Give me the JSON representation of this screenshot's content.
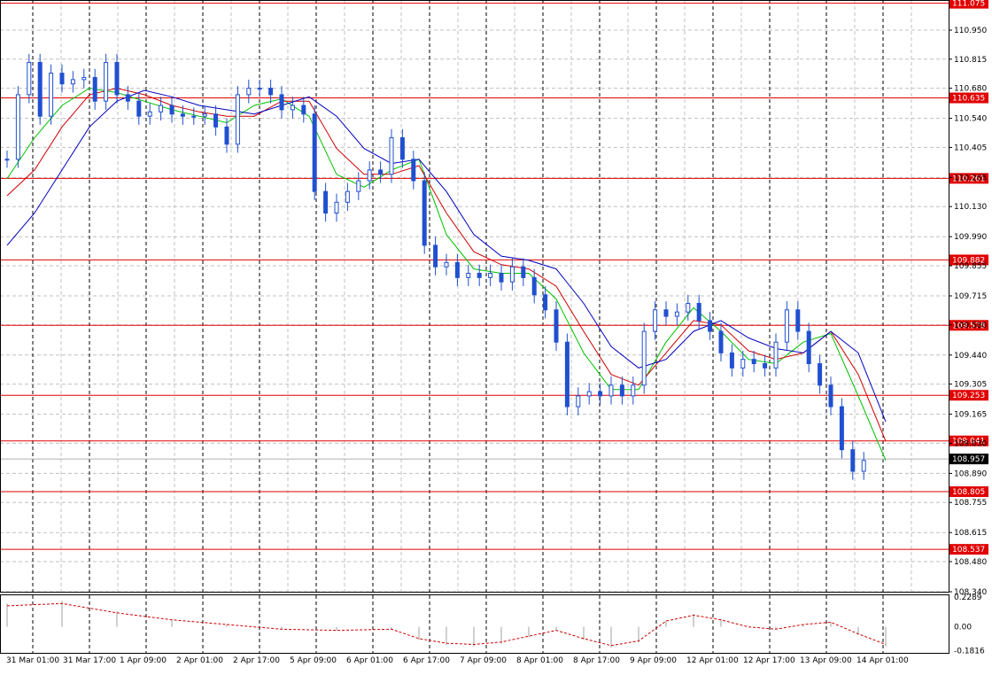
{
  "chart_data": [
    {
      "type": "candlestick",
      "instrument_panel": "main",
      "title": "",
      "x_tick_labels": [
        "31 Mar 01:00",
        "31 Mar 17:00",
        "1 Apr 09:00",
        "2 Apr 01:00",
        "2 Apr 17:00",
        "5 Apr 09:00",
        "6 Apr 01:00",
        "6 Apr 17:00",
        "7 Apr 09:00",
        "8 Apr 01:00",
        "8 Apr 17:00",
        "9 Apr 09:00",
        "12 Apr 01:00",
        "12 Apr 17:00",
        "13 Apr 09:00",
        "14 Apr 01:00"
      ],
      "y_tick_labels": [
        "110.950",
        "110.815",
        "110.680",
        "110.540",
        "110.405",
        "110.265",
        "110.130",
        "109.990",
        "109.855",
        "109.715",
        "109.580",
        "109.440",
        "109.305",
        "109.165",
        "109.030",
        "108.890",
        "108.755",
        "108.615",
        "108.480",
        "108.340"
      ],
      "ylim": [
        108.34,
        111.09
      ],
      "current_price": "108.957",
      "horizontal_levels": [
        "111.075",
        "110.635",
        "110.261",
        "109.882",
        "109.578",
        "109.253",
        "109.041",
        "108.805",
        "108.537"
      ],
      "close_path": [
        [
          0,
          110.35
        ],
        [
          8,
          110.65
        ],
        [
          16,
          110.8
        ],
        [
          24,
          110.55
        ],
        [
          32,
          110.75
        ],
        [
          40,
          110.7
        ],
        [
          48,
          110.72
        ],
        [
          56,
          110.73
        ],
        [
          64,
          110.62
        ],
        [
          72,
          110.8
        ],
        [
          80,
          110.65
        ],
        [
          88,
          110.62
        ],
        [
          96,
          110.55
        ],
        [
          104,
          110.57
        ],
        [
          112,
          110.6
        ],
        [
          120,
          110.56
        ],
        [
          128,
          110.55
        ],
        [
          136,
          110.55
        ],
        [
          144,
          110.56
        ],
        [
          152,
          110.5
        ],
        [
          160,
          110.42
        ],
        [
          168,
          110.65
        ],
        [
          176,
          110.68
        ],
        [
          184,
          110.68
        ],
        [
          192,
          110.65
        ],
        [
          200,
          110.58
        ],
        [
          208,
          110.6
        ],
        [
          216,
          110.56
        ],
        [
          224,
          110.2
        ],
        [
          232,
          110.1
        ],
        [
          240,
          110.15
        ],
        [
          248,
          110.2
        ],
        [
          256,
          110.25
        ],
        [
          264,
          110.3
        ],
        [
          272,
          110.28
        ],
        [
          280,
          110.45
        ],
        [
          288,
          110.35
        ],
        [
          296,
          110.25
        ],
        [
          304,
          109.95
        ],
        [
          312,
          109.85
        ],
        [
          320,
          109.87
        ],
        [
          328,
          109.8
        ],
        [
          336,
          109.82
        ],
        [
          344,
          109.8
        ],
        [
          352,
          109.82
        ],
        [
          360,
          109.78
        ],
        [
          368,
          109.85
        ],
        [
          376,
          109.8
        ],
        [
          384,
          109.72
        ],
        [
          392,
          109.65
        ],
        [
          400,
          109.5
        ],
        [
          408,
          109.2
        ],
        [
          416,
          109.25
        ],
        [
          424,
          109.27
        ],
        [
          432,
          109.25
        ],
        [
          440,
          109.3
        ],
        [
          448,
          109.25
        ],
        [
          456,
          109.3
        ],
        [
          464,
          109.55
        ],
        [
          472,
          109.65
        ],
        [
          480,
          109.62
        ],
        [
          488,
          109.64
        ],
        [
          496,
          109.68
        ],
        [
          504,
          109.6
        ],
        [
          512,
          109.55
        ],
        [
          520,
          109.45
        ],
        [
          528,
          109.38
        ],
        [
          536,
          109.42
        ],
        [
          544,
          109.4
        ],
        [
          552,
          109.38
        ],
        [
          560,
          109.5
        ],
        [
          568,
          109.65
        ],
        [
          576,
          109.55
        ],
        [
          584,
          109.4
        ],
        [
          592,
          109.3
        ],
        [
          600,
          109.2
        ],
        [
          608,
          109.0
        ],
        [
          616,
          108.9
        ],
        [
          624,
          108.95
        ]
      ],
      "series": [
        {
          "name": "",
          "color": "#00c000",
          "values": [
            [
              0,
              110.26
            ],
            [
              20,
              110.45
            ],
            [
              40,
              110.6
            ],
            [
              60,
              110.68
            ],
            [
              80,
              110.66
            ],
            [
              100,
              110.62
            ],
            [
              120,
              110.58
            ],
            [
              140,
              110.55
            ],
            [
              160,
              110.52
            ],
            [
              180,
              110.6
            ],
            [
              200,
              110.63
            ],
            [
              220,
              110.55
            ],
            [
              240,
              110.28
            ],
            [
              260,
              110.22
            ],
            [
              280,
              110.3
            ],
            [
              300,
              110.35
            ],
            [
              320,
              110.0
            ],
            [
              340,
              109.84
            ],
            [
              360,
              109.82
            ],
            [
              380,
              109.82
            ],
            [
              400,
              109.7
            ],
            [
              420,
              109.45
            ],
            [
              440,
              109.28
            ],
            [
              460,
              109.28
            ],
            [
              480,
              109.5
            ],
            [
              500,
              109.66
            ],
            [
              520,
              109.55
            ],
            [
              540,
              109.42
            ],
            [
              560,
              109.4
            ],
            [
              580,
              109.5
            ],
            [
              600,
              109.54
            ],
            [
              620,
              109.25
            ],
            [
              640,
              108.95
            ]
          ]
        },
        {
          "name": "",
          "color": "#d00000",
          "values": [
            [
              0,
              110.18
            ],
            [
              20,
              110.3
            ],
            [
              40,
              110.5
            ],
            [
              60,
              110.65
            ],
            [
              80,
              110.68
            ],
            [
              100,
              110.65
            ],
            [
              120,
              110.6
            ],
            [
              140,
              110.57
            ],
            [
              160,
              110.55
            ],
            [
              180,
              110.55
            ],
            [
              200,
              110.62
            ],
            [
              220,
              110.62
            ],
            [
              240,
              110.4
            ],
            [
              260,
              110.28
            ],
            [
              280,
              110.28
            ],
            [
              300,
              110.32
            ],
            [
              320,
              110.1
            ],
            [
              340,
              109.92
            ],
            [
              360,
              109.86
            ],
            [
              380,
              109.84
            ],
            [
              400,
              109.76
            ],
            [
              420,
              109.55
            ],
            [
              440,
              109.35
            ],
            [
              460,
              109.3
            ],
            [
              480,
              109.45
            ],
            [
              500,
              109.6
            ],
            [
              520,
              109.58
            ],
            [
              540,
              109.46
            ],
            [
              560,
              109.42
            ],
            [
              580,
              109.45
            ],
            [
              600,
              109.55
            ],
            [
              620,
              109.35
            ],
            [
              640,
              109.04
            ]
          ]
        },
        {
          "name": "",
          "color": "#0000c0",
          "values": [
            [
              0,
              109.95
            ],
            [
              20,
              110.1
            ],
            [
              40,
              110.3
            ],
            [
              60,
              110.5
            ],
            [
              80,
              110.62
            ],
            [
              100,
              110.67
            ],
            [
              120,
              110.64
            ],
            [
              140,
              110.6
            ],
            [
              160,
              110.58
            ],
            [
              180,
              110.56
            ],
            [
              200,
              110.6
            ],
            [
              220,
              110.64
            ],
            [
              240,
              110.55
            ],
            [
              260,
              110.4
            ],
            [
              280,
              110.33
            ],
            [
              300,
              110.35
            ],
            [
              320,
              110.2
            ],
            [
              340,
              110.0
            ],
            [
              360,
              109.9
            ],
            [
              380,
              109.88
            ],
            [
              400,
              109.84
            ],
            [
              420,
              109.68
            ],
            [
              440,
              109.48
            ],
            [
              460,
              109.38
            ],
            [
              480,
              109.42
            ],
            [
              500,
              109.55
            ],
            [
              520,
              109.6
            ],
            [
              540,
              109.52
            ],
            [
              560,
              109.47
            ],
            [
              580,
              109.45
            ],
            [
              600,
              109.55
            ],
            [
              620,
              109.45
            ],
            [
              640,
              109.13
            ]
          ]
        }
      ]
    },
    {
      "type": "histogram",
      "instrument_panel": "oscillator",
      "title": "",
      "y_tick_labels": [
        "0.2289",
        "0.00",
        "-0.1816"
      ],
      "ylim": [
        -0.2,
        0.25
      ],
      "signal_color": "#d00000",
      "values": [
        [
          0,
          0.18
        ],
        [
          40,
          0.2
        ],
        [
          80,
          0.12
        ],
        [
          120,
          0.06
        ],
        [
          160,
          0.02
        ],
        [
          200,
          -0.02
        ],
        [
          240,
          -0.03
        ],
        [
          280,
          -0.02
        ],
        [
          300,
          -0.1
        ],
        [
          320,
          -0.14
        ],
        [
          340,
          -0.15
        ],
        [
          360,
          -0.13
        ],
        [
          380,
          -0.08
        ],
        [
          400,
          -0.03
        ],
        [
          420,
          -0.1
        ],
        [
          440,
          -0.16
        ],
        [
          460,
          -0.12
        ],
        [
          480,
          0.05
        ],
        [
          500,
          0.1
        ],
        [
          520,
          0.06
        ],
        [
          540,
          0.0
        ],
        [
          560,
          -0.02
        ],
        [
          580,
          0.02
        ],
        [
          600,
          0.04
        ],
        [
          620,
          -0.06
        ],
        [
          640,
          -0.15
        ]
      ]
    }
  ]
}
